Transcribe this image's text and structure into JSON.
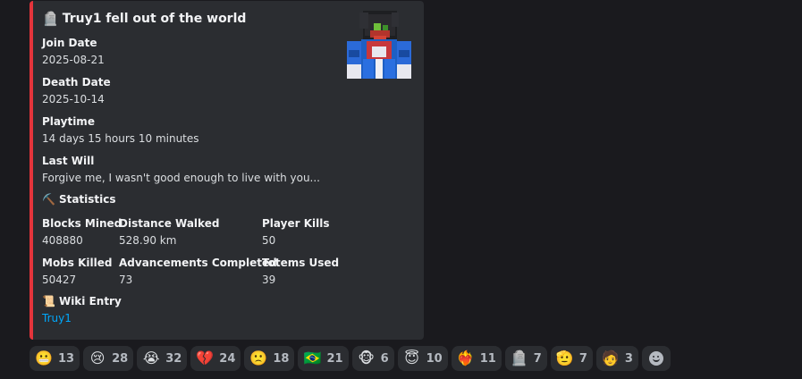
{
  "embed": {
    "title_icon": "headstone-icon",
    "title_emoji": "🪦",
    "title": "Truy1 fell out of the world",
    "accent_color": "#e4343b",
    "fields": {
      "join_date": {
        "name": "Join Date",
        "value": "2025-08-21"
      },
      "death_date": {
        "name": "Death Date",
        "value": "2025-10-14"
      },
      "playtime": {
        "name": "Playtime",
        "value": "14 days 15 hours 10 minutes"
      },
      "last_will": {
        "name": "Last Will",
        "value": "Forgive me, I wasn't good enough to live with you..."
      }
    },
    "statistics_emoji": "⛏️",
    "statistics_title": "Statistics",
    "stats": {
      "blocks_mined": {
        "name": "Blocks Mined",
        "value": "408880"
      },
      "distance_walked": {
        "name": "Distance Walked",
        "value": "528.90 km"
      },
      "player_kills": {
        "name": "Player Kills",
        "value": "50"
      },
      "mobs_killed": {
        "name": "Mobs Killed",
        "value": "50427"
      },
      "advancements": {
        "name": "Advancements Completed",
        "value": "73"
      },
      "totems_used": {
        "name": "Totems Used",
        "value": "39"
      }
    },
    "wiki_emoji": "📜",
    "wiki_title": "Wiki Entry",
    "wiki_link": "Truy1"
  },
  "reactions": [
    {
      "emoji": "😬",
      "icon": "grimace-icon",
      "count": "13"
    },
    {
      "emoji": "😢",
      "icon": "crying-face-icon",
      "count": "28"
    },
    {
      "emoji": "😭",
      "icon": "sobbing-face-icon",
      "count": "32"
    },
    {
      "emoji": "💔",
      "icon": "broken-heart-icon",
      "count": "24"
    },
    {
      "emoji": "🙁",
      "icon": "frowning-face-icon",
      "count": "18"
    },
    {
      "emoji": "🇧🇷",
      "icon": "brazil-flag-icon",
      "count": "21"
    },
    {
      "emoji": "🐵",
      "icon": "monkey-face-icon",
      "count": "6"
    },
    {
      "emoji": "😇",
      "icon": "angel-face-icon",
      "count": "10"
    },
    {
      "emoji": "❤️‍🔥",
      "icon": "heart-on-fire-icon",
      "count": "11"
    },
    {
      "emoji": "🪦",
      "icon": "headstone-icon",
      "count": "7"
    },
    {
      "emoji": "🫡",
      "icon": "saluting-face-icon",
      "count": "7"
    },
    {
      "emoji": "🧑",
      "icon": "blocky-face-icon",
      "count": "3"
    }
  ]
}
